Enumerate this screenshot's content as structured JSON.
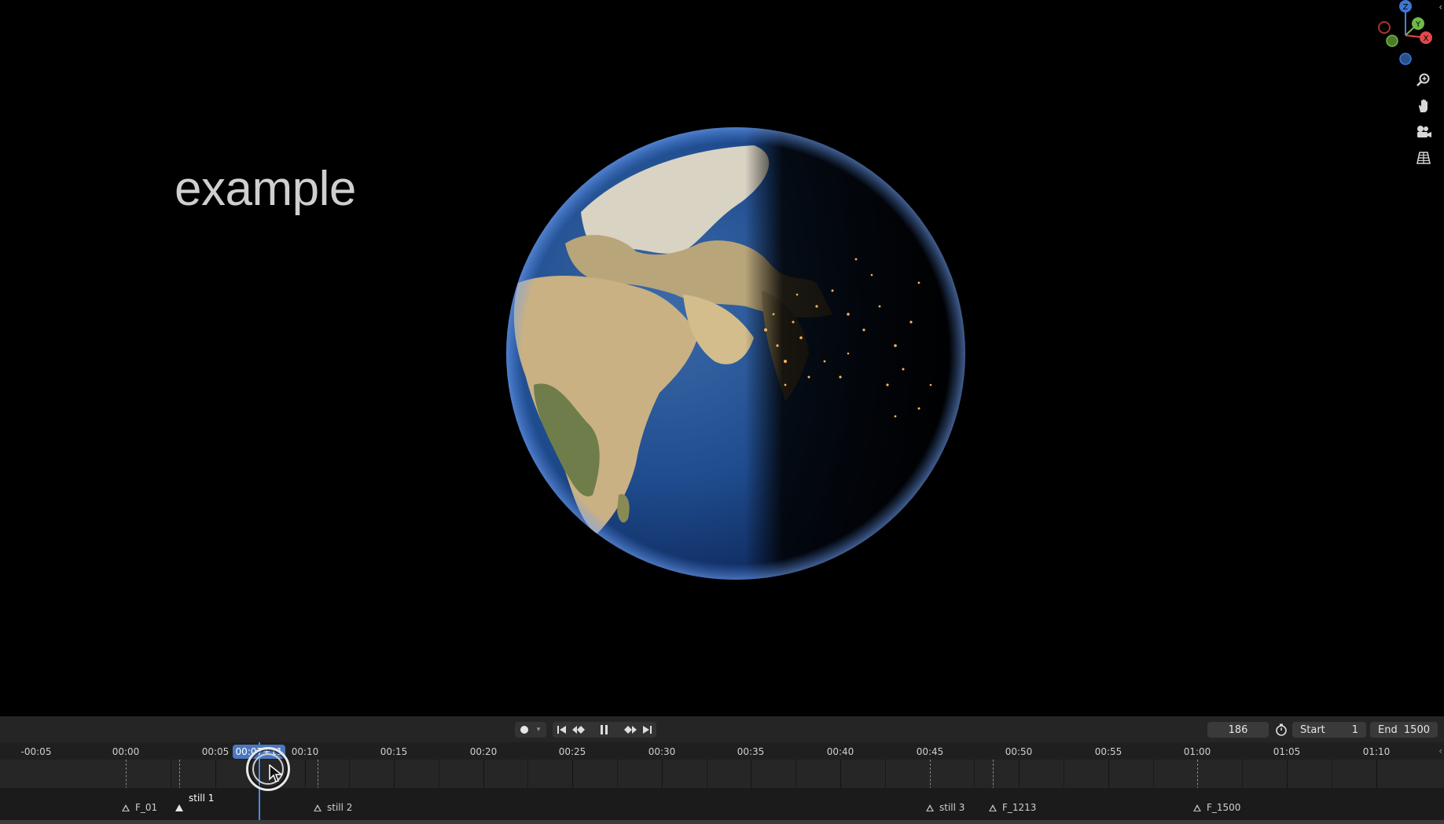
{
  "viewport": {
    "overlay_text": "example",
    "gizmo": {
      "axes": [
        "Z",
        "Y",
        "X"
      ],
      "colors": {
        "x": "#e04a4a",
        "y": "#6fb84a",
        "z": "#4a7fe0"
      }
    },
    "nav_buttons": [
      "zoom-icon",
      "hand-pan-icon",
      "camera-icon",
      "grid-perspective-icon"
    ]
  },
  "timeline": {
    "header": {
      "record_icon": "record-dot-icon",
      "transport": [
        "jump-start-icon",
        "prev-keyframe-icon",
        "pause-icon",
        "next-keyframe-icon",
        "jump-end-icon"
      ],
      "current_frame": "186",
      "start_label": "Start",
      "start_value": "1",
      "end_label": "End",
      "end_value": "1500"
    },
    "ruler_ticks": [
      "-00:05",
      "00:00",
      "00:05",
      "00:10",
      "00:15",
      "00:20",
      "00:25",
      "00:30",
      "00:35",
      "00:40",
      "00:45",
      "00:50",
      "00:55",
      "01:00",
      "01:05",
      "01:10"
    ],
    "playhead_label": "00:07+11",
    "markers": [
      {
        "label": "F_01",
        "selected": false
      },
      {
        "label": "still 1",
        "selected": true
      },
      {
        "label": "still 2",
        "selected": false
      },
      {
        "label": "still 3",
        "selected": false
      },
      {
        "label": "F_1213",
        "selected": false
      },
      {
        "label": "F_1500",
        "selected": false
      }
    ]
  }
}
